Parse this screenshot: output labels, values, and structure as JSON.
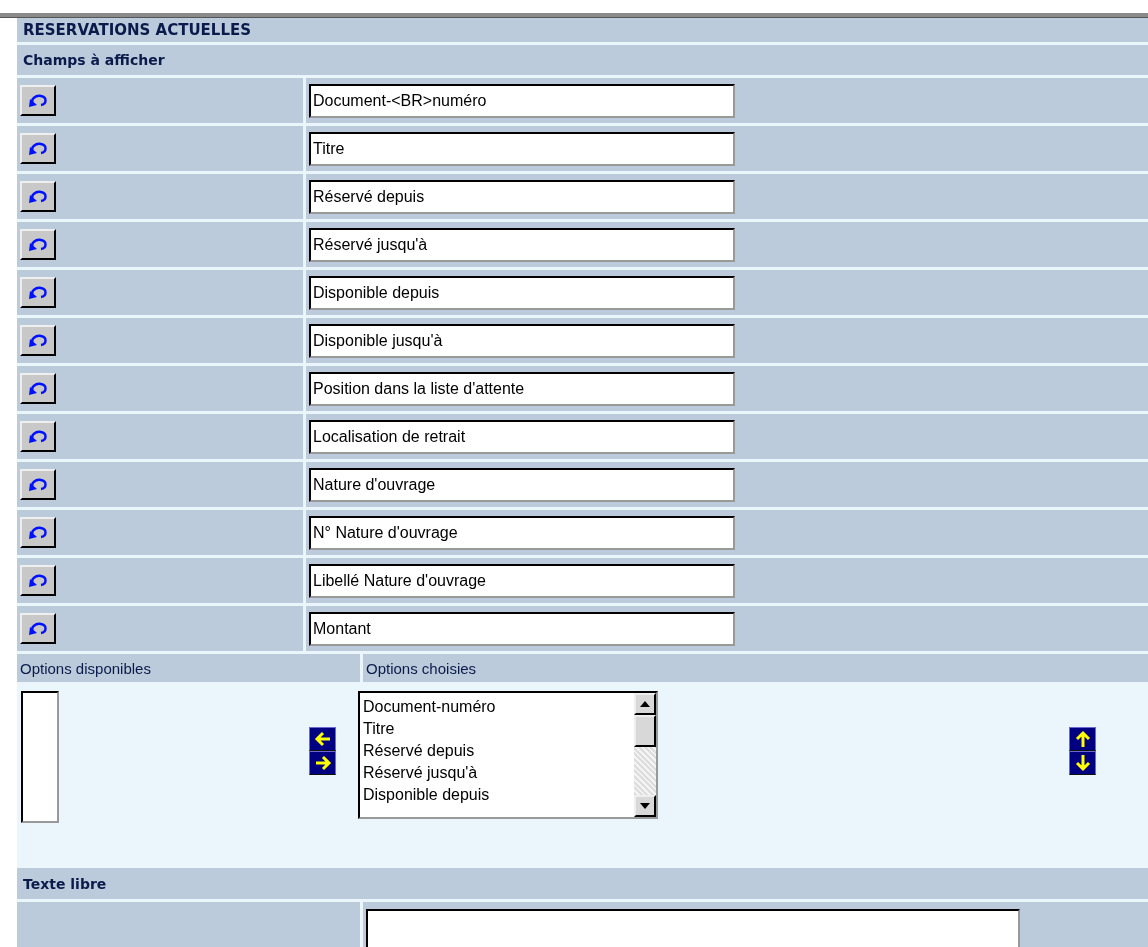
{
  "title": "RESERVATIONS ACTUELLES",
  "fields_section": {
    "heading": "Champs à afficher",
    "fields": [
      {
        "value": "Document-<BR>numéro"
      },
      {
        "value": "Titre"
      },
      {
        "value": "Réservé depuis"
      },
      {
        "value": "Réservé jusqu'à"
      },
      {
        "value": "Disponible depuis"
      },
      {
        "value": "Disponible jusqu'à"
      },
      {
        "value": "Position dans la liste d'attente"
      },
      {
        "value": "Localisation de retrait"
      },
      {
        "value": "Nature d'ouvrage"
      },
      {
        "value": "N° Nature d'ouvrage"
      },
      {
        "value": "Libellé Nature d'ouvrage"
      },
      {
        "value": "Montant"
      }
    ]
  },
  "options": {
    "available_label": "Options disponibles",
    "chosen_label": "Options choisies",
    "chosen": [
      "Document-numéro",
      "Titre",
      "Réservé depuis",
      "Réservé jusqu'à",
      "Disponible depuis"
    ]
  },
  "free_text": {
    "heading": "Texte libre"
  }
}
